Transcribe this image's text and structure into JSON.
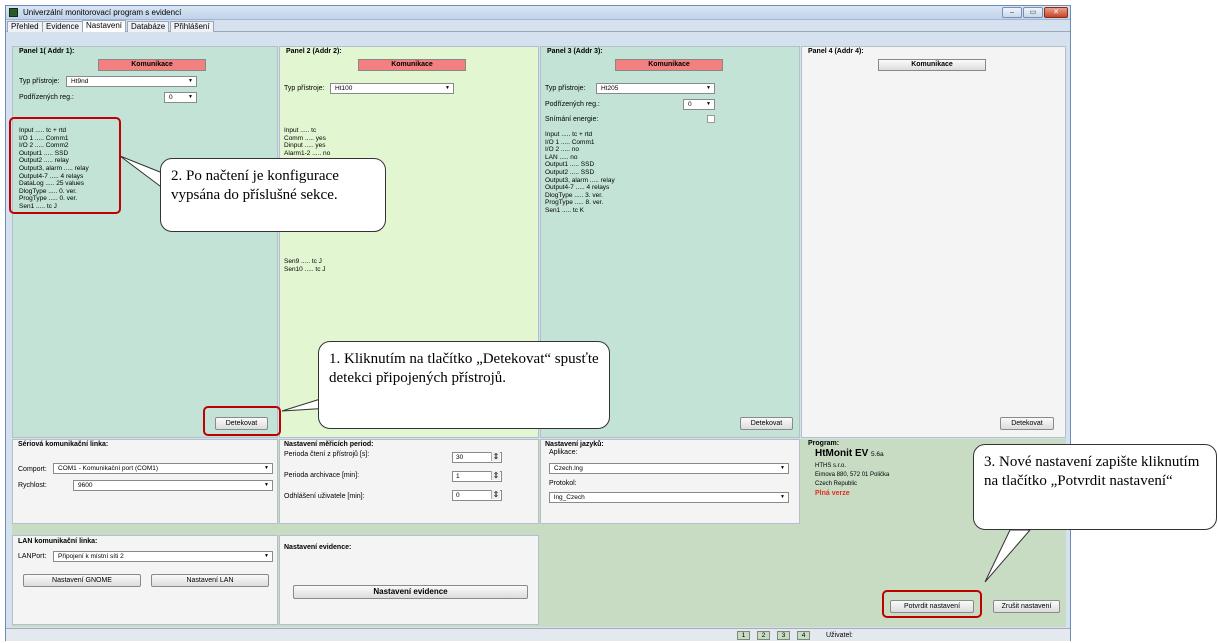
{
  "window": {
    "title": "Univerzální monitorovací program s evidencí"
  },
  "tabs": [
    "Přehled",
    "Evidence",
    "Nastavení",
    "Databáze",
    "Přihlášení"
  ],
  "window_buttons": {
    "min": "–",
    "max": "▭",
    "close": "✕"
  },
  "panel1": {
    "title": "Panel 1( Addr 1):",
    "comm_button": "Komunikace",
    "type_label": "Typ přístroje:",
    "type_value": "Ht9nd",
    "sub_label": "Podřízených reg.:",
    "sub_value": "0",
    "config": "Input ..... tc + rtd\nI/O 1 ..... Comm1\nI/O 2 ..... Comm2\nOutput1 ..... SSD\nOutput2 ..... relay\nOutput3, alarm ..... relay\nOutput4-7 ..... 4 relays\nDataLog ..... 25 values\nDlogType ..... 0. ver.\nProgType ..... 0. ver.\nSen1 ..... tc J",
    "detect_button": "Detekovat"
  },
  "panel2": {
    "title": "Panel 2 (Addr 2):",
    "comm_button": "Komunikace",
    "type_label": "Typ přístroje:",
    "type_value": "Ht100",
    "config": "Input ..... tc\nComm ..... yes\nDinput ..... yes\nAlarm1-2 ..... no",
    "config_tail": "Sen9 ..... tc J\nSen10 ..... tc J"
  },
  "panel3": {
    "title": "Panel 3 (Addr 3):",
    "comm_button": "Komunikace",
    "type_label": "Typ přístroje:",
    "type_value": "Ht205",
    "sub_label": "Podřízených reg.:",
    "sub_value": "0",
    "energy_label": "Snímání energie:",
    "config": "Input ..... tc + rtd\nI/O 1 ..... Comm1\nI/O 2 ..... no\nLAN ..... no\nOutput1 ..... SSD\nOutput2 ..... SSD\nOutput3, alarm ..... relay\nOutput4-7 ..... 4 relays\nDlogType ..... 3. ver.\nProgType ..... 8. ver.\nSen1 ..... tc K",
    "detect_button": "Detekovat"
  },
  "panel4": {
    "title": "Panel 4 (Addr 4):",
    "comm_button": "Komunikace",
    "detect_button": "Detekovat"
  },
  "serial": {
    "title": "Sériová komunikační linka:",
    "port_label": "Comport:",
    "port_value": "COM1 - Komunikační port (COM1)",
    "speed_label": "Rychlost:",
    "speed_value": "9600"
  },
  "measure": {
    "title": "Nastavení měřicích period:",
    "read_label": "Perioda čtení z přístrojů [s]:",
    "read_value": "30",
    "archive_label": "Perioda archivace [min]:",
    "archive_value": "1",
    "logout_label": "Odhlášení uživatele [min]:",
    "logout_value": "0"
  },
  "language": {
    "title": "Nastavení jazyků:",
    "app_label": "Aplikace:",
    "app_value": "Czech.lng",
    "protocol_label": "Protokol:",
    "protocol_value": "lng_Czech"
  },
  "program": {
    "title": "Program:",
    "name": "HtMonit EV",
    "version": "5.6a",
    "company": "HTHS s.r.o.",
    "address": "Eimova 880, 572 01 Polička",
    "country": "Czech Republic",
    "license": "Plná verze"
  },
  "lan": {
    "title": "LAN komunikační linka:",
    "port_label": "LANPort:",
    "port_value": "Připojení k místní síti 2",
    "gnome_button": "Nastavení GNOME",
    "lan_button": "Nastavení LAN"
  },
  "evidence": {
    "title": "Nastavení evidence:",
    "button": "Nastavení evidence"
  },
  "actions": {
    "confirm": "Potvrdit nastavení",
    "cancel": "Zrušit nastavení"
  },
  "status": {
    "pages": [
      "1",
      "2",
      "3",
      "4"
    ],
    "user_label": "Uživatel:"
  },
  "callouts": {
    "c1": "1. Kliknutím na tlačítko „Detekovat“ spusťte detekci připojených přístrojů.",
    "c2": "2. Po načtení je konfigurace vypsána do příslušné sekce.",
    "c3": "3. Nové nastavení zapište kliknutím na tlačítko „Potvrdit nastavení“"
  },
  "colors": {
    "panel1_bg": "#c2e3d6",
    "panel2_bg": "#e3f6d2",
    "panel3_bg": "#c2e3d6",
    "panel4_bg": "#f4f4f4",
    "bottom_bg": "#c8dcc4",
    "comm_red": "#f28080",
    "highlight": "#c00000",
    "license_red": "#e03020"
  }
}
